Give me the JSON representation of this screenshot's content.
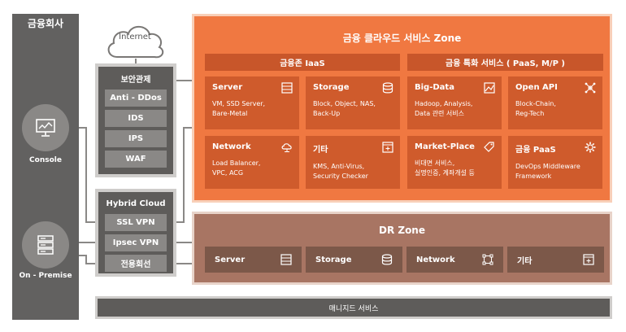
{
  "company": {
    "title": "금융회사",
    "console_label": "Console",
    "onpremise_label": "On - Premise"
  },
  "internet": {
    "label": "Internet"
  },
  "security": {
    "title": "보안관제",
    "items": [
      "Anti - DDos",
      "IDS",
      "IPS",
      "WAF"
    ]
  },
  "hybrid": {
    "title": "Hybrid Cloud",
    "items": [
      "SSL VPN",
      "Ipsec VPN",
      "전용회선"
    ]
  },
  "zone": {
    "title": "금융 클라우드 서비스 Zone",
    "iaas_label": "금융존 IaaS",
    "special_label": "금융 특화 서비스 ( PaaS, M/P )",
    "cards": [
      {
        "title": "Server",
        "desc": "VM, SSD Server,\nBare-Metal",
        "icon": "server-icon"
      },
      {
        "title": "Storage",
        "desc": "Block, Object, NAS,\nBack-Up",
        "icon": "database-icon"
      },
      {
        "title": "Big-Data",
        "desc": "Hadoop, Analysis,\nData 관련 서비스",
        "icon": "chart-image-icon"
      },
      {
        "title": "Open API",
        "desc": "Block-Chain,\nReg-Tech",
        "icon": "network-nodes-icon"
      },
      {
        "title": "Network",
        "desc": "Load Balancer,\nVPC, ACG",
        "icon": "cloud-network-icon"
      },
      {
        "title": "기타",
        "desc": "KMS, Anti-Virus,\nSecurity Checker",
        "icon": "window-plus-icon"
      },
      {
        "title": "Market-Place",
        "desc": "비대면 서비스,\n실명인증, 계좌개설 등",
        "icon": "tag-gear-icon"
      },
      {
        "title": "금융 PaaS",
        "desc": "DevOps Middleware\nFramework",
        "icon": "gear-icon"
      }
    ]
  },
  "dr": {
    "title": "DR Zone",
    "items": [
      {
        "label": "Server",
        "icon": "server-icon"
      },
      {
        "label": "Storage",
        "icon": "database-icon"
      },
      {
        "label": "Network",
        "icon": "network-nodes-icon"
      },
      {
        "label": "기타",
        "icon": "window-plus-icon"
      }
    ]
  },
  "managed": {
    "label": "매니지드 서비스"
  },
  "colors": {
    "gray_dark": "#5e5c5a",
    "gray_mid": "#8a8886",
    "orange": "#f07841",
    "orange_dark": "#cf5b2c",
    "brown": "#a87563"
  }
}
